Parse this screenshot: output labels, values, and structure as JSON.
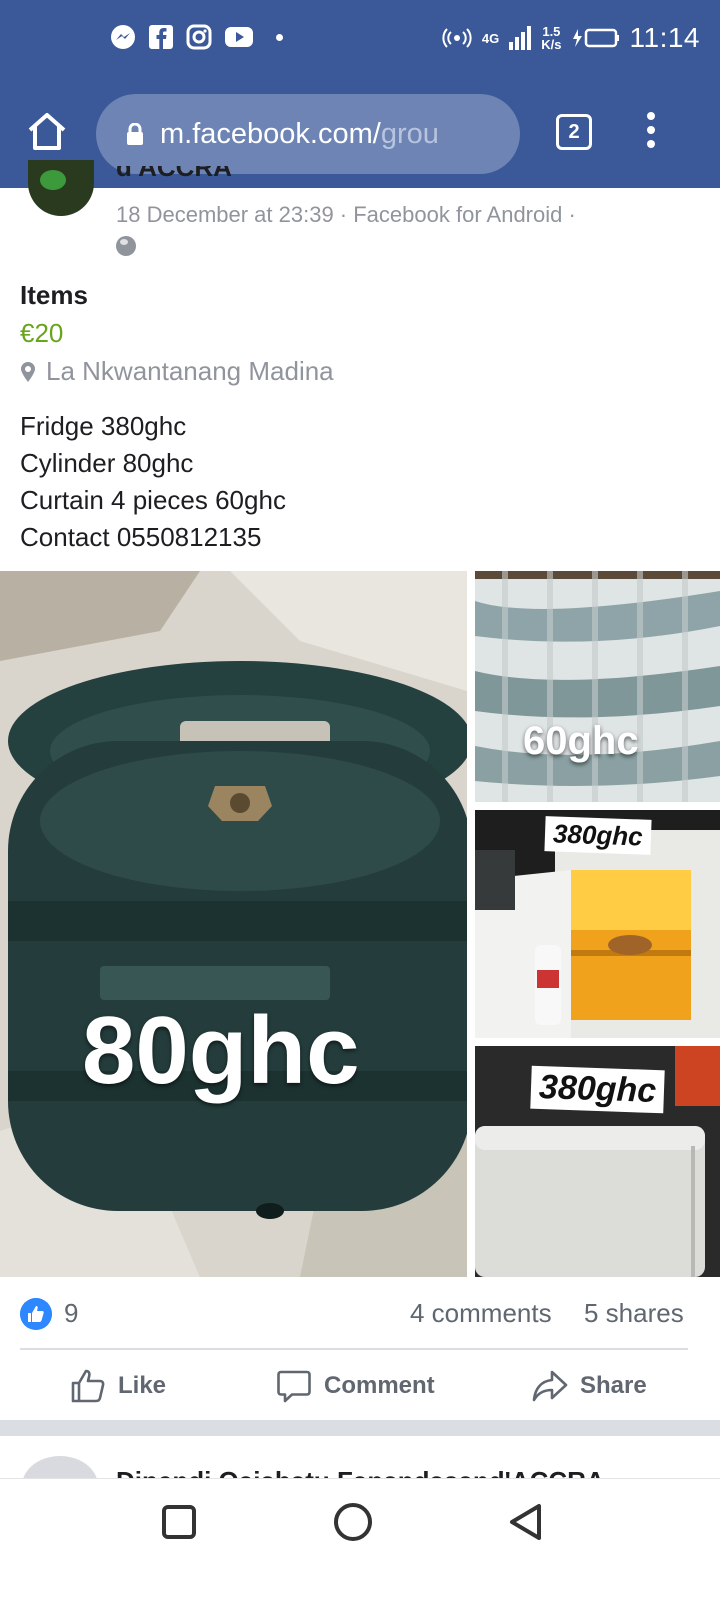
{
  "status_bar": {
    "time": "11:14",
    "network_type": "4G",
    "speed_value": "1.5",
    "speed_unit": "K/s",
    "notification_icons": [
      "messenger-icon",
      "facebook-icon",
      "instagram-icon",
      "youtube-icon"
    ]
  },
  "browser": {
    "url_main": "m.facebook.com/",
    "url_dim": "grou",
    "tab_count": "2"
  },
  "post": {
    "author_partial": "d'ACCRA",
    "meta": "18 December at 23:39 · Facebook for Android ·",
    "item_title": "Items",
    "price": "€20",
    "location": "La Nkwantanang Madina",
    "description_lines": [
      "Fridge 380ghc",
      "Cylinder 80ghc",
      "Curtain 4 pieces 60ghc",
      "Contact 0550812135"
    ],
    "photos": {
      "main_label": "80ghc",
      "curtain_label": "60ghc",
      "fridge_open_label": "380ghc",
      "fridge_closed_label": "380ghc"
    },
    "reactions": {
      "likes": "9",
      "comments": "4 comments",
      "shares": "5 shares"
    },
    "actions": {
      "like": "Like",
      "comment": "Comment",
      "share": "Share"
    }
  },
  "next_post": {
    "author_partial": "Dipendi Qaiabatu Fanandasand'ACCRA"
  },
  "colors": {
    "brand": "#3b5998",
    "price_green": "#68a41c",
    "like_blue": "#2d88ff"
  }
}
